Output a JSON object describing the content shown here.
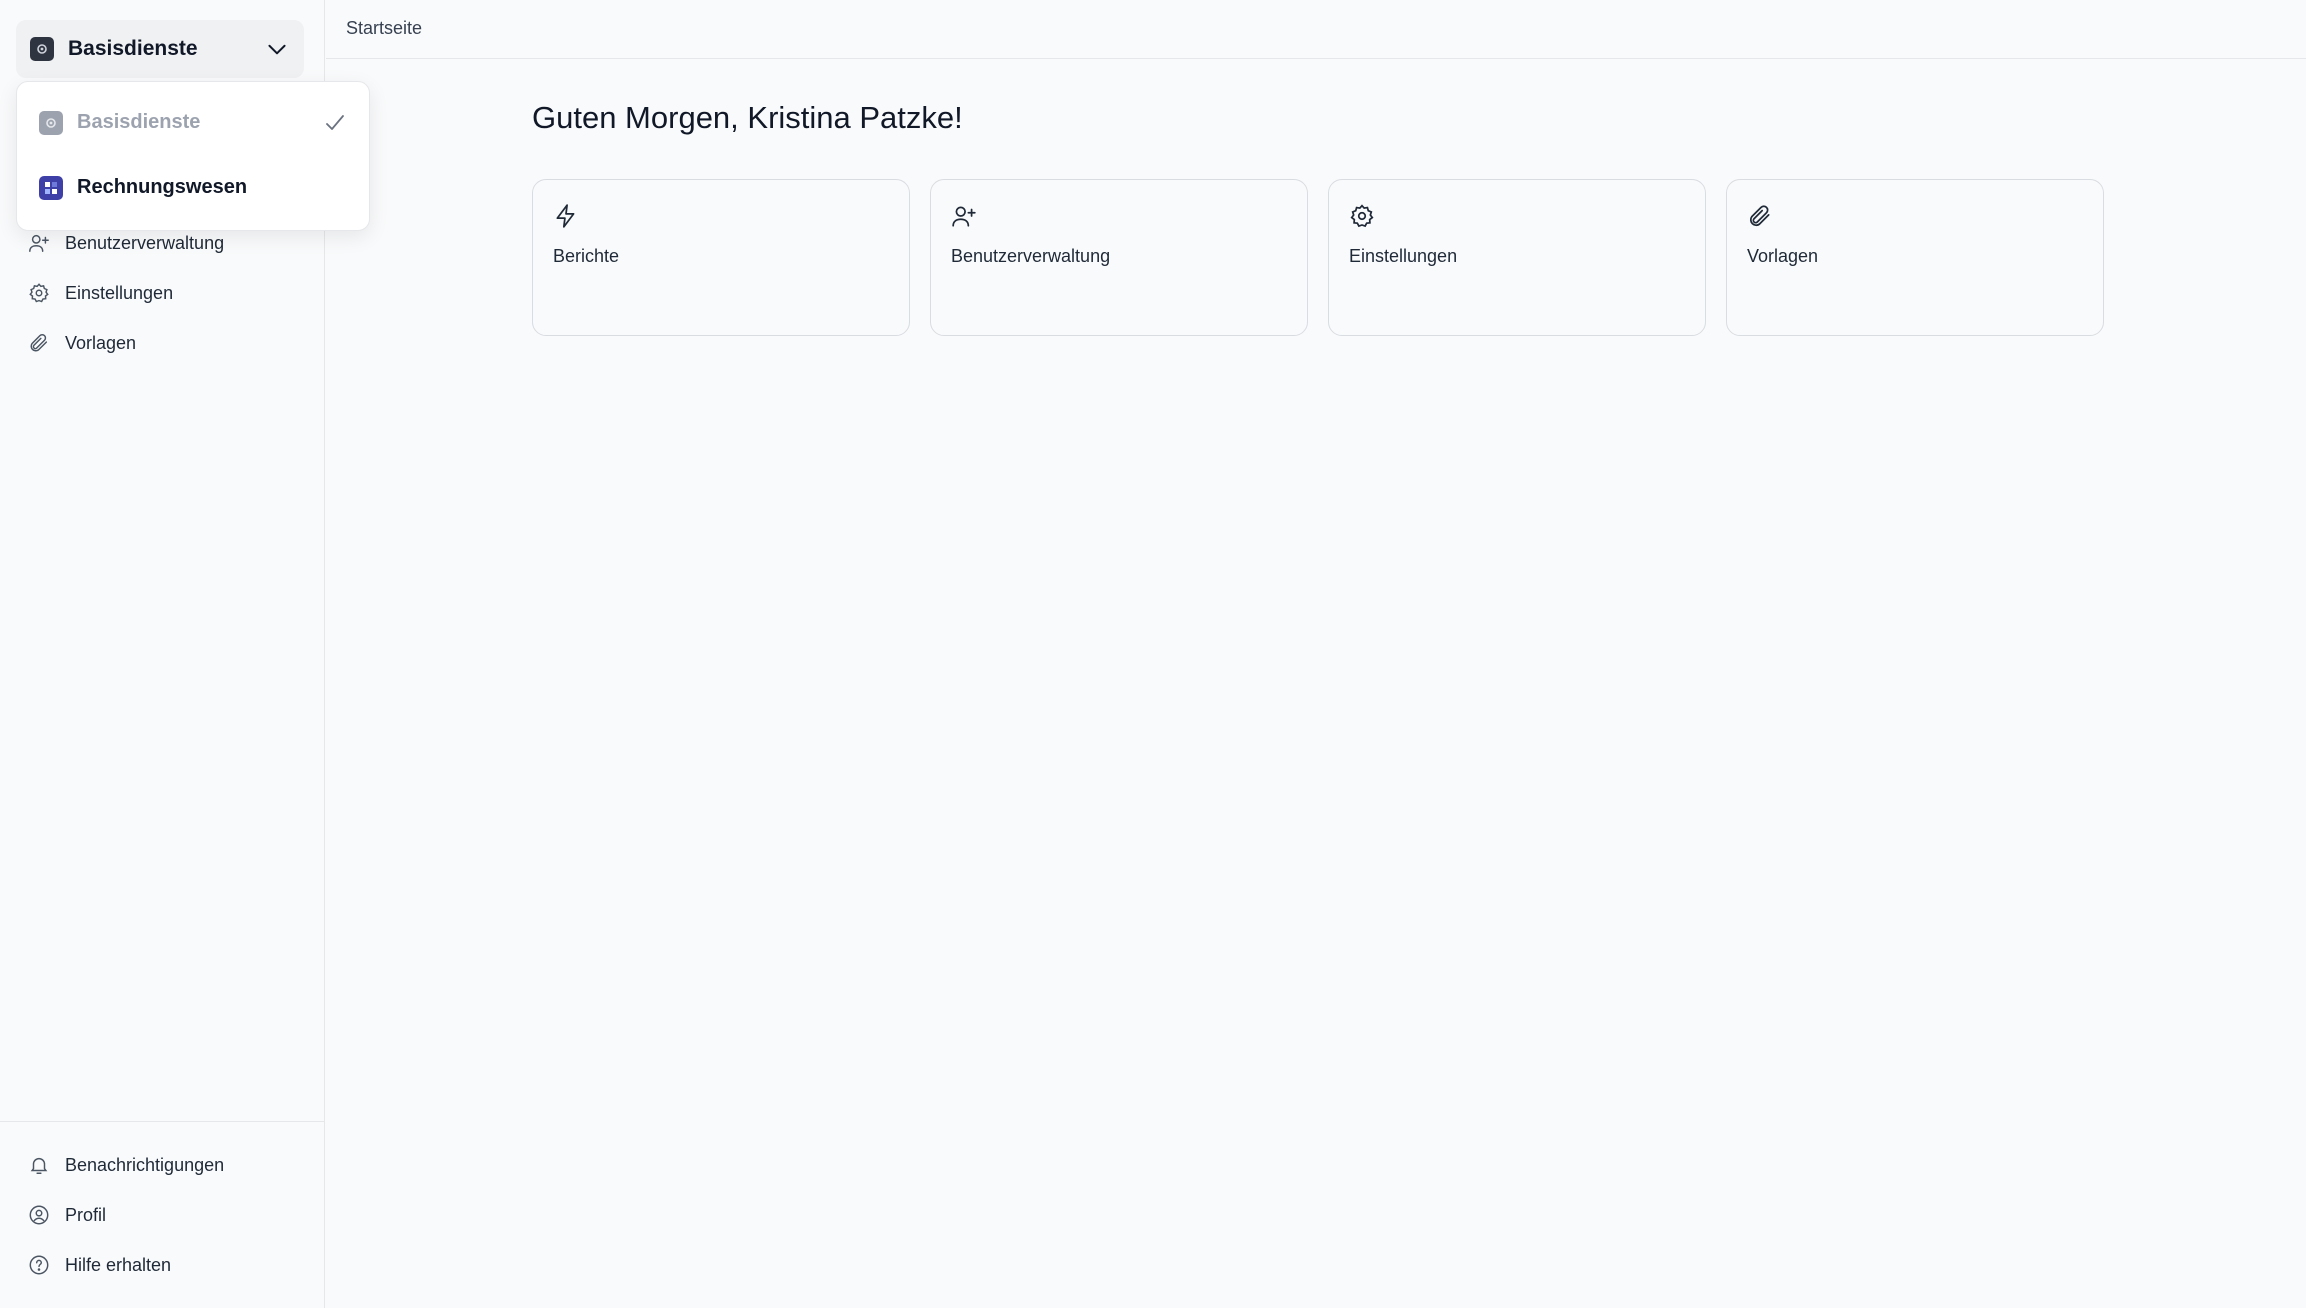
{
  "sidebar": {
    "switcher": {
      "name": "Basisdienste",
      "icon": "app-badge-icon",
      "chevron": "chevron-down-icon"
    },
    "nav_items": [
      {
        "label": "Benutzerverwaltung",
        "icon": "user-plus-icon"
      },
      {
        "label": "Einstellungen",
        "icon": "gear-icon"
      },
      {
        "label": "Vorlagen",
        "icon": "paperclip-icon"
      }
    ],
    "bottom_items": [
      {
        "label": "Benachrichtigungen",
        "icon": "bell-icon"
      },
      {
        "label": "Profil",
        "icon": "user-circle-icon"
      },
      {
        "label": "Hilfe erhalten",
        "icon": "help-circle-icon"
      }
    ]
  },
  "dropdown": {
    "items": [
      {
        "label": "Basisdienste",
        "selected": true,
        "icon": "app-badge-icon",
        "color": "#9ca3af"
      },
      {
        "label": "Rechnungswesen",
        "selected": false,
        "icon": "app-badge-icon",
        "color": "#3f3fa8"
      }
    ]
  },
  "header": {
    "breadcrumb": "Startseite"
  },
  "main": {
    "greeting": "Guten Morgen, Kristina Patzke!",
    "cards": [
      {
        "label": "Berichte",
        "icon": "lightning-icon"
      },
      {
        "label": "Benutzerverwaltung",
        "icon": "user-plus-icon"
      },
      {
        "label": "Einstellungen",
        "icon": "gear-icon"
      },
      {
        "label": "Vorlagen",
        "icon": "paperclip-icon"
      }
    ]
  }
}
